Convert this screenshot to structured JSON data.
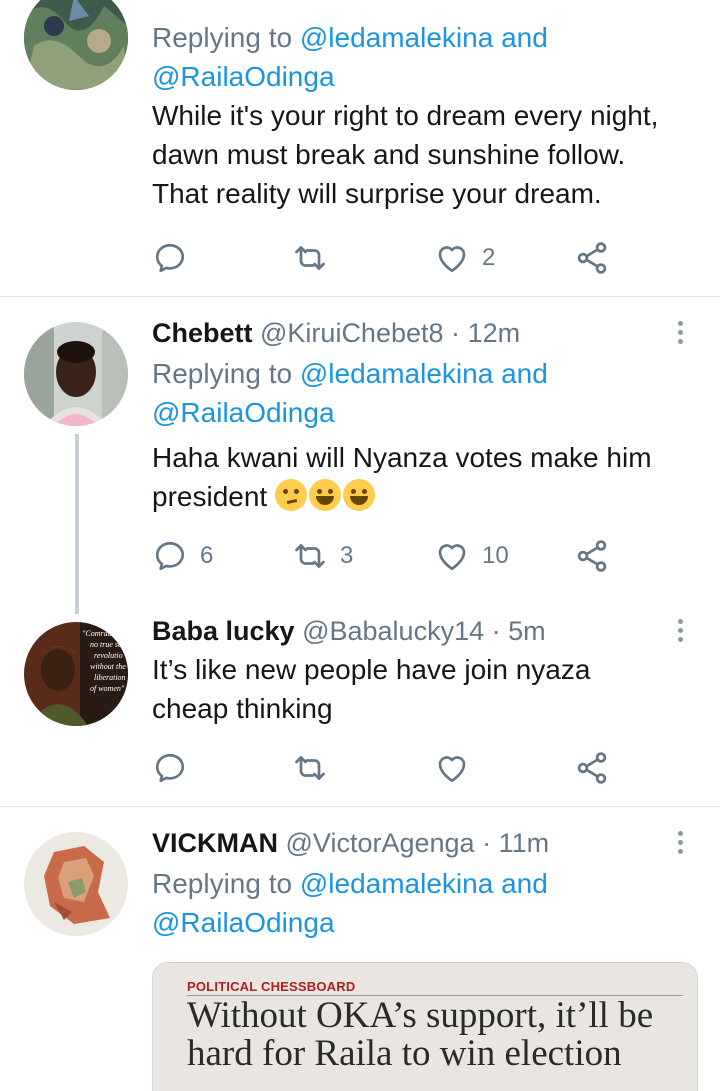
{
  "tweets": [
    {
      "replying_prefix": "Replying to",
      "mention1": "@ledamalekina",
      "and_word": "and",
      "mention2": "@RailaOdinga",
      "body": [
        "While it's your right to dream every night,",
        "dawn must break and sunshine follow.",
        "That reality will surprise your dream."
      ],
      "reply_count": "",
      "retweet_count": "",
      "like_count": "2"
    },
    {
      "name": "Chebett",
      "handle": "@KiruiChebet8",
      "separator": "·",
      "time": "12m",
      "replying_prefix": "Replying to",
      "mention1": "@ledamalekina",
      "and_word": "and",
      "mention2": "@RailaOdinga",
      "body_line1": "Haha kwani will Nyanza votes make him",
      "body_line2": "president",
      "emojis": [
        "thinking-face",
        "tears-of-joy",
        "tears-of-joy"
      ],
      "reply_count": "6",
      "retweet_count": "3",
      "like_count": "10"
    },
    {
      "name": "Baba lucky",
      "handle": "@Babalucky14",
      "separator": "·",
      "time": "5m",
      "body": [
        "It’s like new people have join nyaza",
        "cheap thinking"
      ],
      "avatar_text": [
        "\"Comrades,",
        "no true so",
        "revolutio",
        "without the",
        "liberation",
        "of women\""
      ],
      "reply_count": "",
      "retweet_count": "",
      "like_count": ""
    },
    {
      "name": "VICKMAN",
      "handle": "@VictorAgenga",
      "separator": "·",
      "time": "11m",
      "replying_prefix": "Replying to",
      "mention1": "@ledamalekina",
      "and_word": "and",
      "mention2": "@RailaOdinga",
      "media": {
        "kicker": "POLITICAL CHESSBOARD",
        "headline": "Without OKA’s support, it’ll be hard for Raila to win election"
      }
    }
  ],
  "colors": {
    "accent": "#1b95e0",
    "secondary_text": "#657786",
    "divider": "#e1e8ed",
    "icon": "#657786"
  }
}
